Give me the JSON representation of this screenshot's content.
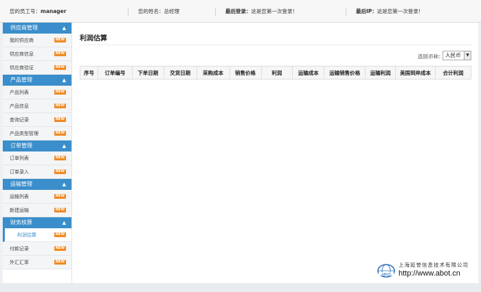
{
  "topbar": {
    "employee_id_label": "您的员工号：",
    "employee_id": "manager",
    "name_label": "您的姓名：",
    "name": "总经理",
    "last_login_label": "最后登录：",
    "last_login": "这是您第一次登录！",
    "last_ip_label": "最后IP：",
    "last_ip": "这是您第一次登录！"
  },
  "sidebar": {
    "badge": "NEW",
    "groups": [
      {
        "title": "供应商管理",
        "items": [
          {
            "label": "我的供应商"
          },
          {
            "label": "供应商信息"
          },
          {
            "label": "供应商验证"
          }
        ]
      },
      {
        "title": "产品管理",
        "items": [
          {
            "label": "产品列表"
          },
          {
            "label": "产品信息"
          },
          {
            "label": "查询记录"
          },
          {
            "label": "产品类型管理"
          }
        ]
      },
      {
        "title": "订单管理",
        "items": [
          {
            "label": "订单列表"
          },
          {
            "label": "订单录入"
          }
        ]
      },
      {
        "title": "运输管理",
        "items": [
          {
            "label": "运输列表"
          },
          {
            "label": "新建运输"
          }
        ]
      },
      {
        "title": "财务核算",
        "items": [
          {
            "label": "利润估算",
            "active": true
          },
          {
            "label": "付款记录"
          },
          {
            "label": "外汇汇率"
          }
        ]
      }
    ]
  },
  "main": {
    "title": "利润估算",
    "currency_label": "选则币种：",
    "currency_value": "人民币",
    "columns": [
      "序号",
      "订单编号",
      "下单日期",
      "交货日期",
      "采购成本",
      "销售价格",
      "利润",
      "运输成本",
      "运输销售价格",
      "运输利润",
      "美国到岸成本",
      "合计利润"
    ]
  },
  "company": {
    "name_cn": "上海延誉信息技术有限公司",
    "url": "http://www.abot.cn",
    "logo_text": "ABOT"
  },
  "colors": {
    "accent": "#3a8ecb",
    "badge": "#f08a24"
  }
}
